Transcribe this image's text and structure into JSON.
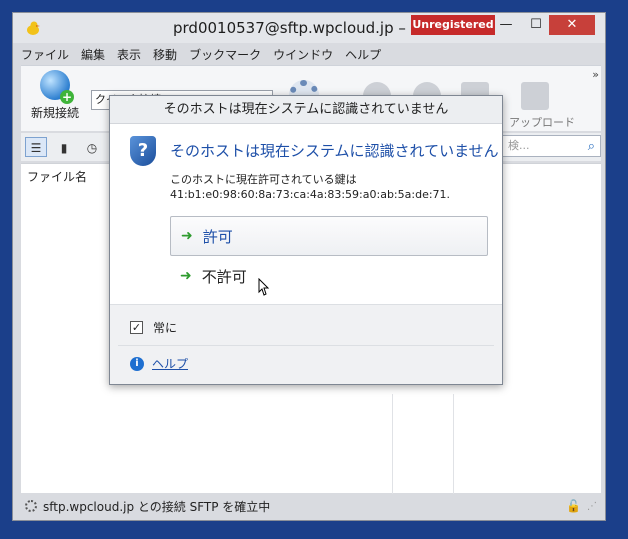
{
  "window": {
    "title": "prd0010537@sftp.wpcloud.jp – S",
    "badge": "Unregistered",
    "minimize": "—",
    "maximize": "☐",
    "close": "✕"
  },
  "menu": [
    "ファイル",
    "編集",
    "表示",
    "移動",
    "ブックマーク",
    "ウインドウ",
    "ヘルプ"
  ],
  "toolbar": {
    "new_connection": "新規接続",
    "quick_connect": "クイック接続",
    "upload": "アップロード",
    "overflow": "»"
  },
  "search": {
    "placeholder": "検..."
  },
  "file_list": {
    "column_filename": "ファイル名"
  },
  "status": {
    "text": "sftp.wpcloud.jp との接続 SFTP を確立中"
  },
  "dialog": {
    "title": "そのホストは現在システムに認識されていません",
    "main_instruction": "そのホストは現在システムに認識されていません",
    "content_line1": "このホストに現在許可されている鍵は",
    "content_line2": "41:b1:e0:98:60:8a:73:ca:4a:83:59:a0:ab:5a:de:71.",
    "allow": "許可",
    "deny": "不許可",
    "always": "常に",
    "help": "ヘルプ",
    "always_checked": true
  }
}
